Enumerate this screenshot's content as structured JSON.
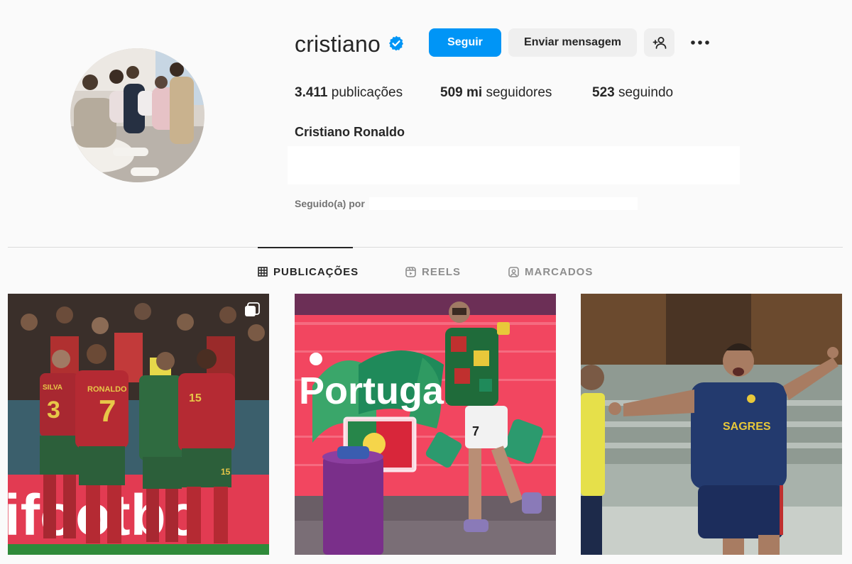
{
  "profile": {
    "username": "cristiano",
    "full_name": "Cristiano Ronaldo",
    "verified_icon": "verified-badge-icon",
    "accent_color": "#0095f6"
  },
  "actions": {
    "follow_label": "Seguir",
    "message_label": "Enviar mensagem",
    "add_person_icon": "add-person-icon",
    "more_icon": "more-options-icon"
  },
  "stats": {
    "posts_value": "3.411",
    "posts_label": "publicações",
    "followers_value": "509 mi",
    "followers_label": "seguidores",
    "following_value": "523",
    "following_label": "seguindo"
  },
  "followed_by_label": "Seguido(a) por",
  "tabs": [
    {
      "label": "PUBLICAÇÕES",
      "icon": "grid-icon",
      "active": true
    },
    {
      "label": "REELS",
      "icon": "reels-icon",
      "active": false
    },
    {
      "label": "MARCADOS",
      "icon": "tagged-icon",
      "active": false
    }
  ],
  "posts": [
    {
      "icon": "multiple-photos-icon",
      "banner_text": "ifootbo",
      "jersey_numbers": [
        "3",
        "7",
        "15"
      ],
      "jersey_names": [
        "SILVA",
        "RONALDO"
      ]
    },
    {
      "banner_text": "Portugal",
      "jersey_numbers": [
        "7"
      ]
    },
    {
      "sponsor_text": "SAGRES"
    }
  ]
}
